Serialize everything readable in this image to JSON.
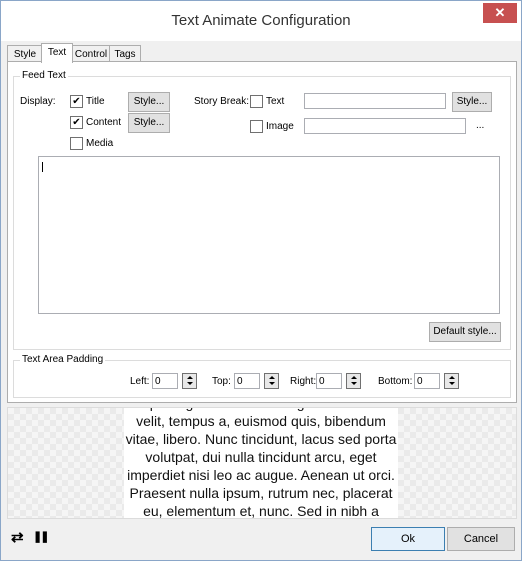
{
  "window": {
    "title": "Text Animate Configuration",
    "close_glyph": "✕"
  },
  "tabs": [
    "Style",
    "Text",
    "Control",
    "Tags"
  ],
  "feed_text": {
    "group_label": "Feed Text",
    "display_label": "Display:",
    "title_label": "Title",
    "title_checked": true,
    "content_label": "Content",
    "content_checked": true,
    "media_label": "Media",
    "media_checked": false,
    "style_button": "Style...",
    "story_break_label": "Story Break:",
    "text_label": "Text",
    "text_checked": false,
    "image_label": "Image",
    "image_checked": false,
    "text_field_value": "",
    "image_field_value": "",
    "browse_glyph": "...",
    "editor_value": "",
    "default_style_button": "Default style..."
  },
  "padding": {
    "group_label": "Text Area Padding",
    "left_label": "Left:",
    "left_value": "0",
    "top_label": "Top:",
    "top_value": "0",
    "right_label": "Right:",
    "right_value": "0",
    "bottom_label": "Bottom:",
    "bottom_value": "0"
  },
  "preview": {
    "text": "adipiscing elit. Aenean congue diam a nisi velit, tempus a, euismod quis, bibendum vitae, libero. Nunc tincidunt, lacus sed porta volutpat, dui nulla tincidunt arcu, eget imperdiet nisi leo ac augue. Aenean ut orci. Praesent nulla ipsum, rutrum nec, placerat eu, elementum et, nunc. Sed in nibh a massa condimentum fermentum. Nulla"
  },
  "footer": {
    "loop_icon": "⇄",
    "pause_icon": "❚❚",
    "ok_button": "Ok",
    "cancel_button": "Cancel"
  }
}
